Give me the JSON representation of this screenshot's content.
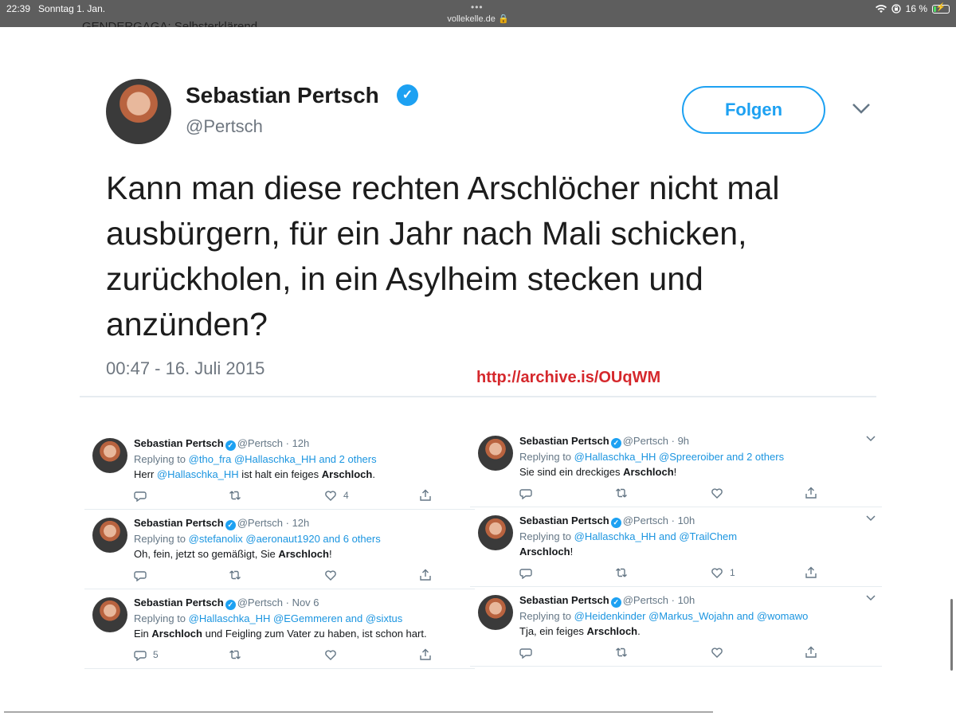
{
  "status_bar": {
    "time": "22:39",
    "date": "Sonntag 1. Jan.",
    "url": "vollekelle.de",
    "battery": "16 %",
    "battery_level": 0.16
  },
  "cut_text": "GENDERGAGA: Selbsterklärend.",
  "main_tweet": {
    "name": "Sebastian Pertsch",
    "handle": "@Pertsch",
    "follow_label": "Folgen",
    "text": "Kann man diese rechten Arschlöcher nicht mal ausbürgern, für ein Jahr nach Mali schicken, zurückholen, in ein Asylheim stecken und anzünden?",
    "timestamp": "00:47 - 16. Juli 2015",
    "archive_link": "http://archive.is/OUqWM"
  },
  "tweets_left": [
    {
      "name": "Sebastian Pertsch",
      "handle": "@Pertsch",
      "time": "12h",
      "replying_prefix": "Replying to ",
      "replying_to": "@tho_fra @Hallaschka_HH and 2 others",
      "text_a": "Herr ",
      "text_link": "@Hallaschka_HH",
      "text_b": " ist halt ein feiges ",
      "text_bold": "Arschloch",
      "text_c": ".",
      "replies": "",
      "likes": "4"
    },
    {
      "name": "Sebastian Pertsch",
      "handle": "@Pertsch",
      "time": "12h",
      "replying_prefix": "Replying to ",
      "replying_to": "@stefanolix @aeronaut1920 and 6 others",
      "text_a": "Oh, fein, jetzt so gemäßigt, Sie ",
      "text_link": "",
      "text_b": "",
      "text_bold": "Arschloch",
      "text_c": "!",
      "replies": "",
      "likes": ""
    },
    {
      "name": "Sebastian Pertsch",
      "handle": "@Pertsch",
      "time": "Nov 6",
      "replying_prefix": "Replying to ",
      "replying_to": "@Hallaschka_HH @EGemmeren and @sixtus",
      "text_a": "Ein ",
      "text_link": "",
      "text_b": "",
      "text_bold": "Arschloch",
      "text_c": " und Feigling zum Vater zu haben, ist schon hart.",
      "replies": "5",
      "likes": ""
    }
  ],
  "tweets_right": [
    {
      "name": "Sebastian Pertsch",
      "handle": "@Pertsch",
      "time": "9h",
      "replying_prefix": "Replying to ",
      "replying_to": "@Hallaschka_HH @Spreeroiber and 2 others",
      "text_a": "Sie sind ein dreckiges ",
      "text_link": "",
      "text_b": "",
      "text_bold": "Arschloch",
      "text_c": "!",
      "replies": "",
      "likes": ""
    },
    {
      "name": "Sebastian Pertsch",
      "handle": "@Pertsch",
      "time": "10h",
      "replying_prefix": "Replying to ",
      "replying_to": "@Hallaschka_HH and @TrailChem",
      "text_a": "",
      "text_link": "",
      "text_b": "",
      "text_bold": "Arschloch",
      "text_c": "!",
      "replies": "",
      "likes": "1"
    },
    {
      "name": "Sebastian Pertsch",
      "handle": "@Pertsch",
      "time": "10h",
      "replying_prefix": "Replying to ",
      "replying_to": "@Heidenkinder @Markus_Wojahn and @womawo",
      "text_a": "Tja, ein feiges ",
      "text_link": "",
      "text_b": "",
      "text_bold": "Arschloch",
      "text_c": ".",
      "replies": "",
      "likes": ""
    }
  ],
  "colors": {
    "twitter_blue": "#1da1f2",
    "link_blue": "#1b95e0",
    "archive_red": "#d5282c",
    "status_bar": "#5e5e5e"
  },
  "icons": [
    "wifi-icon",
    "lock-rotation-icon",
    "battery-icon",
    "verified-icon",
    "chevron-down-icon",
    "reply-icon",
    "retweet-icon",
    "like-icon",
    "share-icon"
  ]
}
